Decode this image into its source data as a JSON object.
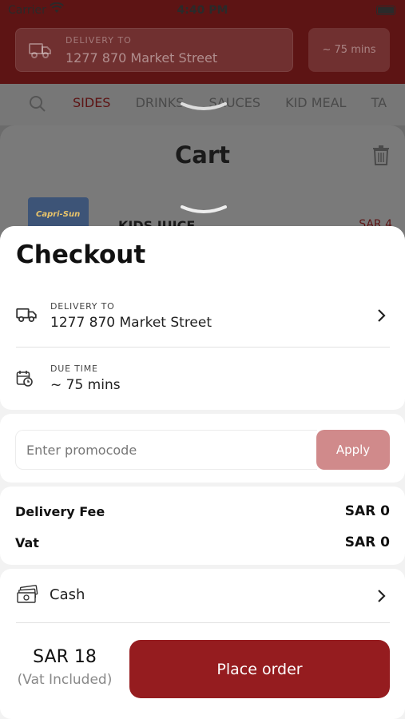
{
  "status_bar": {
    "carrier": "Carrier",
    "time": "4:40 PM"
  },
  "header": {
    "delivery_label": "DELIVERY TO",
    "delivery_address": "1277 870 Market Street",
    "eta": "~ 75 mins"
  },
  "categories": [
    {
      "label": "SIDES",
      "active": true
    },
    {
      "label": "DRINKS",
      "active": false
    },
    {
      "label": "SAUCES",
      "active": false
    },
    {
      "label": "KID MEAL",
      "active": false
    },
    {
      "label": "TA",
      "active": false
    }
  ],
  "cart": {
    "title": "Cart",
    "item_thumb_text": "Capri-Sun",
    "item_name": "KIDS JUICE",
    "item_price": "SAR 4"
  },
  "checkout": {
    "title": "Checkout",
    "delivery_label": "DELIVERY TO",
    "delivery_address": "1277 870 Market Street",
    "due_label": "DUE TIME",
    "due_value": "~ 75 mins",
    "promo_placeholder": "Enter promocode",
    "apply_label": "Apply",
    "delivery_fee_label": "Delivery Fee",
    "delivery_fee_value": "SAR 0",
    "vat_label": "Vat",
    "vat_value": "SAR 0",
    "payment_method": "Cash",
    "total": "SAR 18",
    "total_note": "(Vat Included)",
    "place_order_label": "Place order"
  },
  "colors": {
    "brand": "#951c1f",
    "apply_disabled": "#d08a8b",
    "sheet_bg": "#f2f2f2",
    "card_bg": "#ffffff"
  },
  "icons": {
    "delivery": "truck-icon",
    "due_time": "calendar-clock-icon",
    "payment": "cash-icon",
    "chevron": "chevron-right-icon",
    "search": "search-icon",
    "trash": "trash-icon"
  }
}
